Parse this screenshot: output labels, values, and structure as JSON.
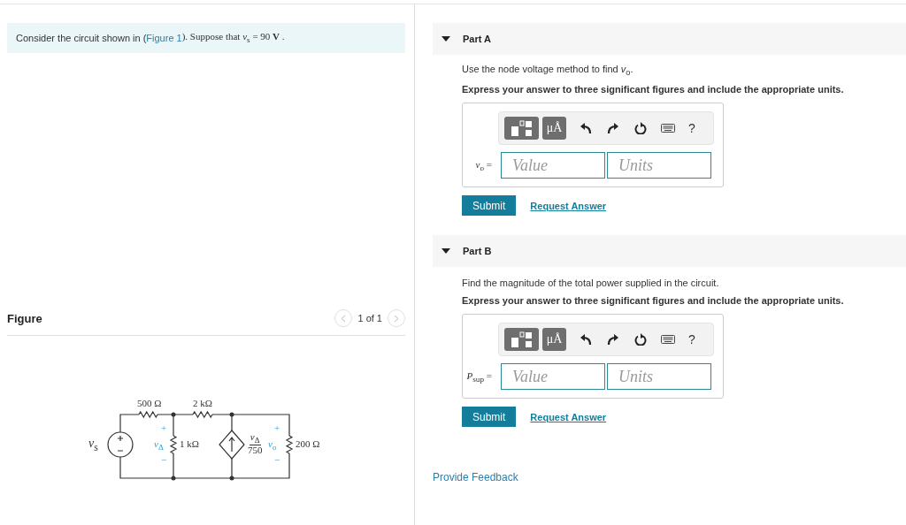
{
  "intro": {
    "text": "Consider the circuit shown in (",
    "link": "Figure 1",
    "after": "). Suppose that *v*$_{s}$ = 90 **V** ."
  },
  "figure": {
    "title": "Figure",
    "pager": "1 of 1",
    "labels": [
      {
        "kind": "value",
        "text": "500 Ω"
      },
      {
        "kind": "value",
        "text": "2 kΩ"
      },
      {
        "kind": "source",
        "text": "*v*$_{s}$"
      },
      {
        "kind": "sign",
        "text": "+"
      },
      {
        "kind": "variable",
        "text": "*v*$_{Δ}$"
      },
      {
        "kind": "value",
        "text": "1 kΩ"
      },
      {
        "kind": "sign",
        "text": "−"
      },
      {
        "kind": "fraction",
        "text": "*v*$_{Δ}$",
        "denominator": "750"
      },
      {
        "kind": "sign",
        "text": "+"
      },
      {
        "kind": "variable",
        "text": "*v*$_{o}$"
      },
      {
        "kind": "sign",
        "text": "−"
      },
      {
        "kind": "value",
        "text": "200 Ω"
      }
    ]
  },
  "parts": [
    {
      "title": "Part A",
      "expanded": true,
      "prompt": "Use the node voltage method to find *v*$_{o}$.",
      "instruction": "Express your answer to three significant figures and include the appropriate units.",
      "toolbar": [
        {
          "kind": "templates"
        },
        {
          "kind": "units",
          "text": "μÅ"
        },
        {
          "kind": "undo"
        },
        {
          "kind": "redo"
        },
        {
          "kind": "reset"
        },
        {
          "kind": "keyboard"
        },
        {
          "kind": "help",
          "text": "?"
        }
      ],
      "variable": "*v*$_{o}$ =",
      "value_placeholder": "Value",
      "units_placeholder": "Units",
      "submit": "Submit",
      "request": "Request Answer"
    },
    {
      "title": "Part B",
      "expanded": true,
      "prompt": "Find the magnitude of the total power supplied in the circuit.",
      "instruction": "Express your answer to three significant figures and include the appropriate units.",
      "toolbar": [
        {
          "kind": "templates"
        },
        {
          "kind": "units",
          "text": "μÅ"
        },
        {
          "kind": "undo"
        },
        {
          "kind": "redo"
        },
        {
          "kind": "reset"
        },
        {
          "kind": "keyboard"
        },
        {
          "kind": "help",
          "text": "?"
        }
      ],
      "variable": "*P*$_{sup}$ =",
      "value_placeholder": "Value",
      "units_placeholder": "Units",
      "submit": "Submit",
      "request": "Request Answer"
    }
  ],
  "feedback": "Provide Feedback"
}
